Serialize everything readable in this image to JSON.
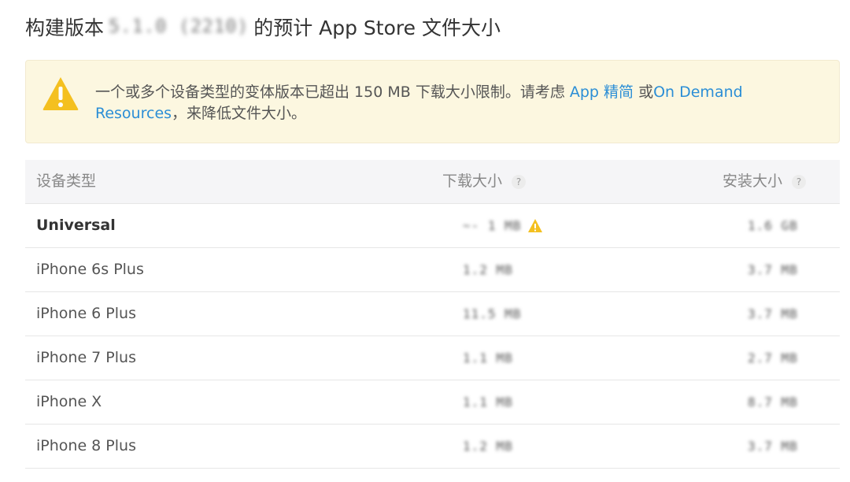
{
  "title": {
    "prefix": "构建版本",
    "version_masked": "5.1.0 (2210)",
    "suffix": "的预计 App Store 文件大小"
  },
  "alert": {
    "icon": "warning-triangle-icon",
    "text_1": "一个或多个设备类型的变体版本已超出 150 MB 下载大小限制。请考虑 ",
    "link_1": "App 精简",
    "text_2": " 或",
    "link_2": "On Demand Resources",
    "text_3": "，来降低文件大小。",
    "colors": {
      "background": "#fcf7e0",
      "icon": "#f4c020",
      "link": "#2b8ed6"
    }
  },
  "table": {
    "headers": {
      "device": "设备类型",
      "download": "下载大小",
      "install": "安装大小",
      "help": "?"
    },
    "rows": [
      {
        "device": "Universal",
        "download": "~- 1 MB",
        "install": "1.6 GB",
        "warning": true
      },
      {
        "device": "iPhone 6s Plus",
        "download": "1.2 MB",
        "install": "3.7 MB"
      },
      {
        "device": "iPhone 6 Plus",
        "download": "11.5 MB",
        "install": "3.7 MB"
      },
      {
        "device": "iPhone 7 Plus",
        "download": "1.1 MB",
        "install": "2.7 MB"
      },
      {
        "device": "iPhone X",
        "download": "1.1 MB",
        "install": "8.7 MB"
      },
      {
        "device": "iPhone 8 Plus",
        "download": "1.2 MB",
        "install": "3.7 MB"
      }
    ]
  }
}
